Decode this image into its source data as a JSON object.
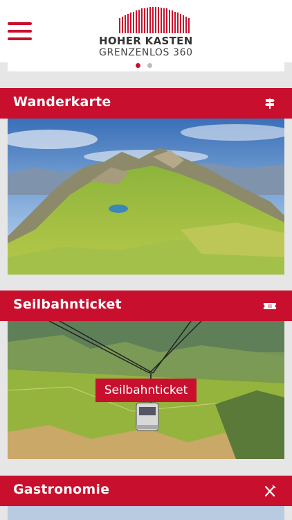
{
  "header": {
    "menu_icon": "hamburger-menu-icon",
    "logo": {
      "line1": "HOHER KASTEN",
      "line2": "GRENZENLOS 360"
    }
  },
  "slider": {
    "dot_count": 2,
    "active_index": 0
  },
  "sections": [
    {
      "title": "Wanderkarte",
      "icon": "signpost-icon"
    },
    {
      "title": "Seilbahnticket",
      "icon": "ticket-icon",
      "overlay_label": "Seilbahnticket"
    },
    {
      "title": "Gastronomie",
      "icon": "fork-knife-icon"
    }
  ],
  "colors": {
    "brand_red": "#c8102e",
    "background": "#e6e6e6",
    "header_bg": "#ffffff"
  }
}
